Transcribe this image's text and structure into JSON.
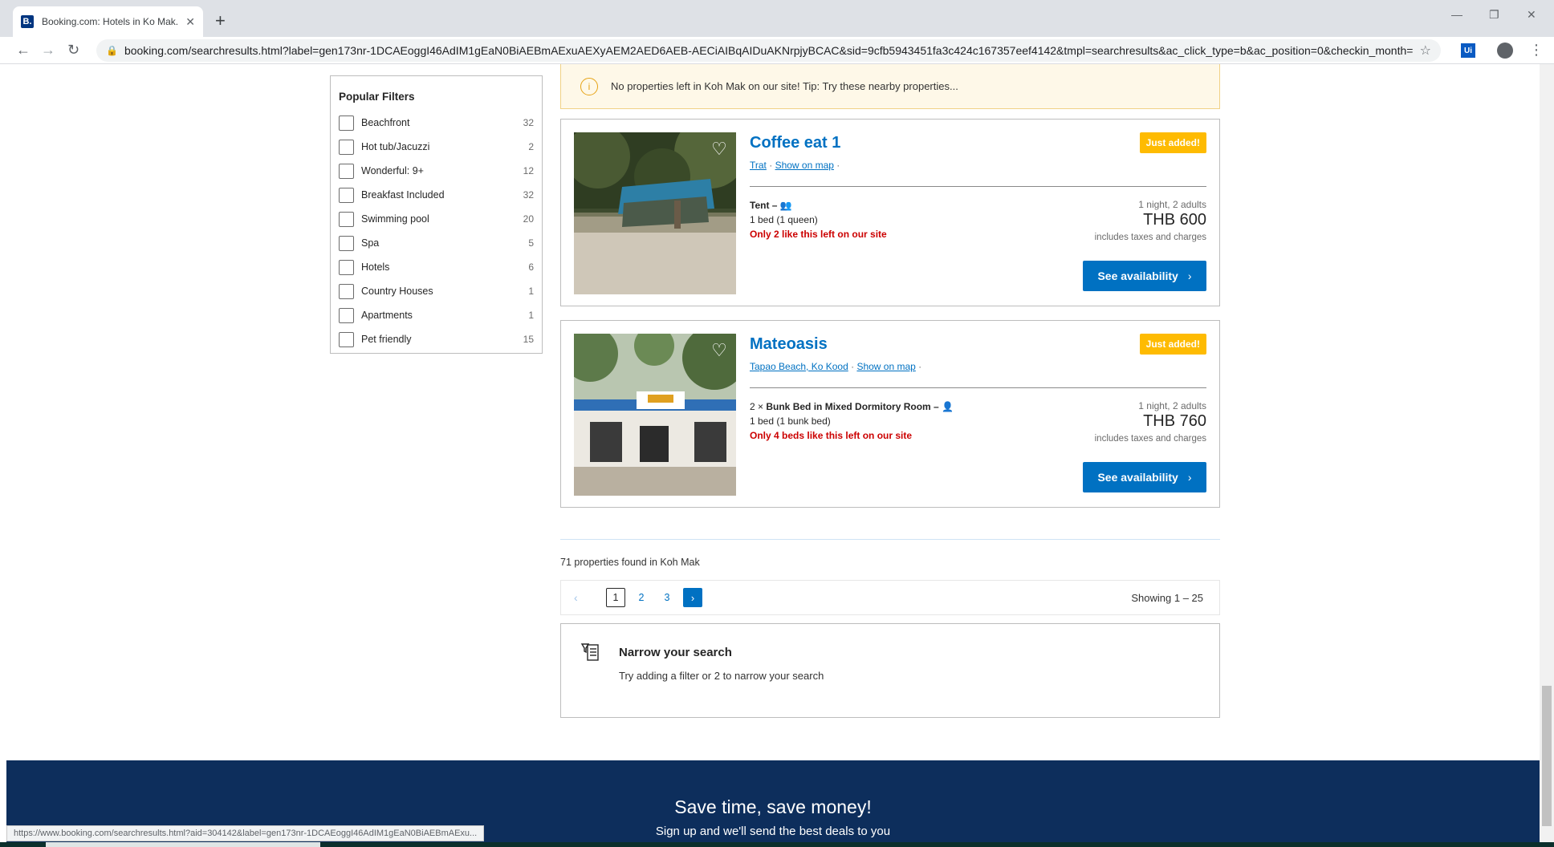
{
  "browser": {
    "tab_title": "Booking.com: Hotels in Ko Mak.",
    "favicon_letter": "B.",
    "url": "booking.com/searchresults.html?label=gen173nr-1DCAEoggI46AdIM1gEaN0BiAEBmAExuAEXyAEM2AED6AEB-AECiAIBqAIDuAKNrpjyBCAC&sid=9cfb5943451fa3c424c167357eef4142&tmpl=searchresults&ac_click_type=b&ac_position=0&checkin_month=2...",
    "ext_label": "Ui",
    "status_url": "https://www.booking.com/searchresults.html?aid=304142&label=gen173nr-1DCAEoggI46AdIM1gEaN0BiAEBmAExu..."
  },
  "filters": {
    "title": "Popular Filters",
    "items": [
      {
        "label": "Beachfront",
        "count": "32"
      },
      {
        "label": "Hot tub/Jacuzzi",
        "count": "2"
      },
      {
        "label": "Wonderful: 9+",
        "count": "12"
      },
      {
        "label": "Breakfast Included",
        "count": "32"
      },
      {
        "label": "Swimming pool",
        "count": "20"
      },
      {
        "label": "Spa",
        "count": "5"
      },
      {
        "label": "Hotels",
        "count": "6"
      },
      {
        "label": "Country Houses",
        "count": "1"
      },
      {
        "label": "Apartments",
        "count": "1"
      },
      {
        "label": "Pet friendly",
        "count": "15"
      }
    ]
  },
  "banner": {
    "message": "No properties left in Koh Mak on our site! Tip: Try these nearby properties..."
  },
  "properties": [
    {
      "name": "Coffee eat 1",
      "location": "Trat",
      "map_link": "Show on map",
      "badge": "Just added!",
      "room": "Tent",
      "room_prefix": "",
      "bed": "1 bed (1 queen)",
      "scarcity": "Only 2 like this left on our site",
      "stay": "1 night, 2 adults",
      "price": "THB 600",
      "taxes": "includes taxes and charges",
      "cta": "See availability"
    },
    {
      "name": "Mateoasis",
      "location": "Tapao Beach, Ko Kood",
      "map_link": "Show on map",
      "badge": "Just added!",
      "room": "Bunk Bed in Mixed Dormitory Room",
      "room_prefix": "2 ×",
      "bed": "1 bed (1 bunk bed)",
      "scarcity": "Only 4 beds like this left on our site",
      "stay": "1 night, 2 adults",
      "price": "THB 760",
      "taxes": "includes taxes and charges",
      "cta": "See availability"
    }
  ],
  "results": {
    "found": "71 properties found in Koh Mak",
    "pages": [
      "1",
      "2",
      "3"
    ],
    "current_page": "1",
    "showing": "Showing 1 – 25"
  },
  "narrow": {
    "title": "Narrow your search",
    "subtitle": "Try adding a filter or 2 to narrow your search"
  },
  "footer": {
    "title": "Save time, save money!",
    "subtitle": "Sign up and we'll send the best deals to you"
  },
  "colors": {
    "brand_blue": "#0071c2",
    "badge_yellow": "#febb02",
    "scarcity_red": "#cc0000",
    "footer_navy": "#0d2e5c"
  }
}
